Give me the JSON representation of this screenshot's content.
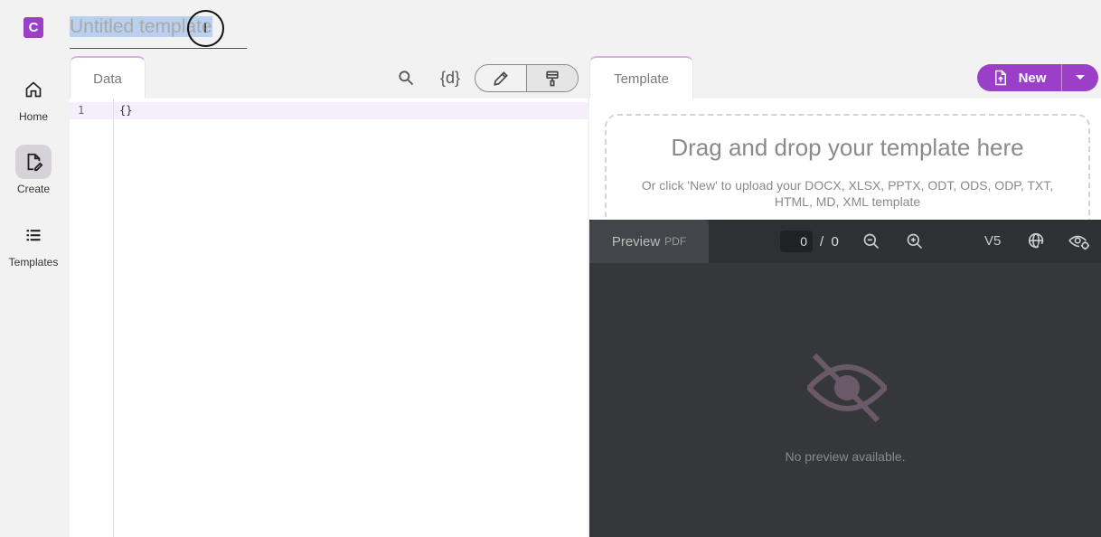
{
  "app": {
    "logo_letter": "C",
    "title_value": "Untitled template"
  },
  "sidebar": {
    "items": [
      {
        "label": "Home",
        "icon": "home-icon"
      },
      {
        "label": "Create",
        "icon": "create-document-icon",
        "active": true
      },
      {
        "label": "Templates",
        "icon": "list-icon"
      }
    ]
  },
  "data_panel": {
    "tab_label": "Data",
    "editor": {
      "line_number": "1",
      "code": "{}"
    },
    "tools": {
      "search": "search-icon",
      "variables": "{d}",
      "edit": "pencil-icon",
      "format": "paint-roller-icon"
    }
  },
  "template_panel": {
    "tab_label": "Template",
    "dropzone_title": "Drag and drop your template here",
    "dropzone_subtitle": "Or click 'New' to upload your DOCX, XLSX, PPTX, ODT, ODS, ODP, TXT, HTML, MD, XML template",
    "new_button_label": "New"
  },
  "preview": {
    "tab_label": "Preview",
    "tab_format": "PDF",
    "current_page": "0",
    "page_separator": "/",
    "total_pages": "0",
    "version": "V5",
    "empty_message": "No preview available."
  },
  "colors": {
    "accent": "#9b3fc9",
    "preview_bg": "#35373b"
  }
}
